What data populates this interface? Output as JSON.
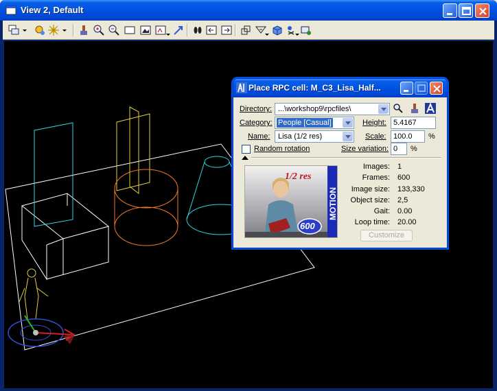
{
  "window": {
    "title": "View 2, Default"
  },
  "toolbar": {
    "buttons": [
      "view-attributes-icon",
      "display-style-icon",
      "rendering-icon",
      "update-icon",
      "zoom-in-icon",
      "zoom-out-icon",
      "window-area-icon",
      "fit-view-icon",
      "rotate-view-icon",
      "pan-view-icon",
      "walk-icon",
      "previous-view-icon",
      "next-view-icon",
      "clip-volume-icon",
      "clip-mask-icon",
      "view-box-icon",
      "camera-icon",
      "view-toggles-icon"
    ]
  },
  "dialog": {
    "title": "Place RPC cell: M_C3_Lisa_Half...",
    "directory": {
      "label": "Directory:",
      "value": "...\\workshop9\\rpcfiles\\"
    },
    "category": {
      "label": "Category:",
      "value": "People [Casual]"
    },
    "name": {
      "label": "Name:",
      "value": "Lisa (1/2 res)"
    },
    "height": {
      "label": "Height:",
      "value": "5.4167"
    },
    "scale": {
      "label": "Scale:",
      "value": "100.0",
      "unit": "%"
    },
    "random_rotation": {
      "label": "Random rotation",
      "checked": false
    },
    "size_variation": {
      "label": "Size variation:",
      "value": "0",
      "unit": "%"
    },
    "preview": {
      "res_text": "1/2 res",
      "brand_text": "MOTION",
      "frames_badge": "600"
    },
    "info": [
      {
        "label": "Images:",
        "value": "1"
      },
      {
        "label": "Frames:",
        "value": "600"
      },
      {
        "label": "Image size:",
        "value": "133,330"
      },
      {
        "label": "Object size:",
        "value": "2,5"
      },
      {
        "label": "Gait:",
        "value": "0.00"
      },
      {
        "label": "Loop time:",
        "value": "20.00"
      }
    ],
    "customize_label": "Customize"
  },
  "colors": {
    "titlebar": "#0054e3",
    "viewport_bg": "#000000",
    "cyan_geometry": "#2fd6e6",
    "orange_geometry": "#f07a2a",
    "yellow_geometry": "#e8d040",
    "white_geometry": "#ffffff"
  }
}
